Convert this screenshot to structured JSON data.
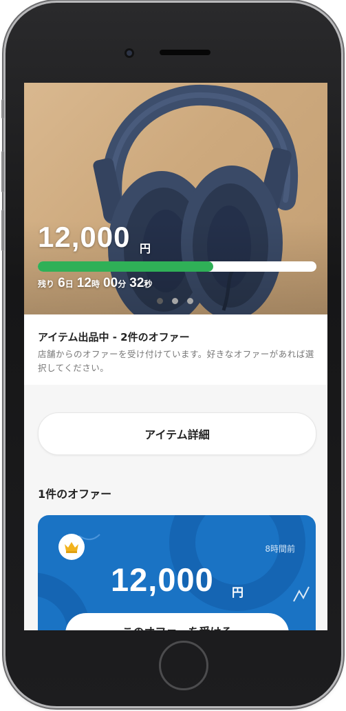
{
  "hero": {
    "price": "12,000",
    "currency": "円",
    "progress": 0.63,
    "timer": {
      "remaining_label": "残り",
      "days": "6",
      "days_unit": "日",
      "hours": "12",
      "hours_unit": "時",
      "minutes": "00",
      "minutes_unit": "分",
      "seconds": "32",
      "seconds_unit": "秒"
    },
    "carousel": {
      "count": 3,
      "active": 0
    }
  },
  "status": {
    "title": "アイテム出品中 - 2件のオファー",
    "description": "店舗からのオファーを受け付けています。好きなオファーがあれば選択してください。"
  },
  "detail_button": {
    "label": "アイテム詳細"
  },
  "offers": {
    "heading": "1件のオファー",
    "items": [
      {
        "badge_icon": "crown-icon",
        "time": "8時間前",
        "price": "12,000",
        "currency": "円",
        "accept_label": "このオファーを受ける"
      }
    ]
  },
  "colors": {
    "accent_green": "#2fb057",
    "card_blue": "#1a73c4"
  }
}
